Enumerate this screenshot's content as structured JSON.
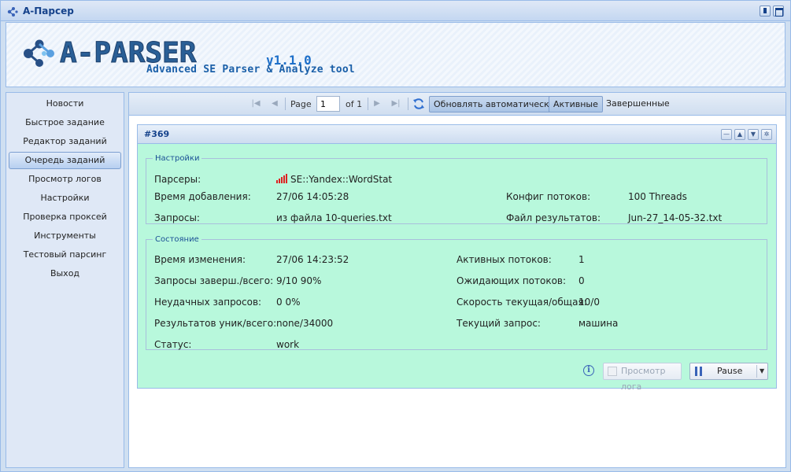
{
  "window": {
    "title": "A-Парсер"
  },
  "logo": {
    "name": "A-PARSER",
    "version": "v1.1.0",
    "tagline": "Advanced SE Parser & Analyze tool"
  },
  "sidebar": {
    "items": [
      {
        "label": "Новости"
      },
      {
        "label": "Быстрое задание"
      },
      {
        "label": "Редактор заданий"
      },
      {
        "label": "Очередь заданий",
        "active": true
      },
      {
        "label": "Просмотр логов"
      },
      {
        "label": "Настройки"
      },
      {
        "label": "Проверка проксей"
      },
      {
        "label": "Инструменты"
      },
      {
        "label": "Тестовый парсинг"
      },
      {
        "label": "Выход"
      }
    ]
  },
  "toolbar": {
    "page_label": "Page",
    "page_value": "1",
    "of_label": "of 1",
    "auto_refresh": "Обновлять автоматически",
    "active": "Активные",
    "finished": "Завершенные"
  },
  "job": {
    "title": "#369",
    "settings": {
      "legend": "Настройки",
      "parsers_label": "Парсеры:",
      "parsers_value": "SE::Yandex::WordStat",
      "added_label": "Время добавления:",
      "added_value": "27/06 14:05:28",
      "queries_label": "Запросы:",
      "queries_value": "из файла 10-queries.txt",
      "threads_config_label": "Конфиг потоков:",
      "threads_config_value": "100 Threads",
      "result_file_label": "Файл результатов:",
      "result_file_value": "Jun-27_14-05-32.txt"
    },
    "state": {
      "legend": "Состояние",
      "changed_label": "Время изменения:",
      "changed_value": "27/06 14:23:52",
      "queries_done_label": "Запросы заверш./всего:",
      "queries_done_value": "9/10 90%",
      "failed_label": "Неудачных запросов:",
      "failed_value": "0 0%",
      "results_label": "Результатов уник/всего:",
      "results_value": "none/34000",
      "status_label": "Статус:",
      "status_value": "work",
      "active_threads_label": "Активных потоков:",
      "active_threads_value": "1",
      "waiting_threads_label": "Ожидающих потоков:",
      "waiting_threads_value": "0",
      "speed_label": "Скорость текущая/общая:",
      "speed_value": "10/0",
      "current_query_label": "Текущий запрос:",
      "current_query_value": "машина"
    },
    "buttons": {
      "view_log": "Просмотр лога",
      "pause": "Pause"
    }
  },
  "colors": {
    "panel_bg": "#b8f8dc",
    "accent": "#15428b",
    "frame": "#99bbe8"
  }
}
